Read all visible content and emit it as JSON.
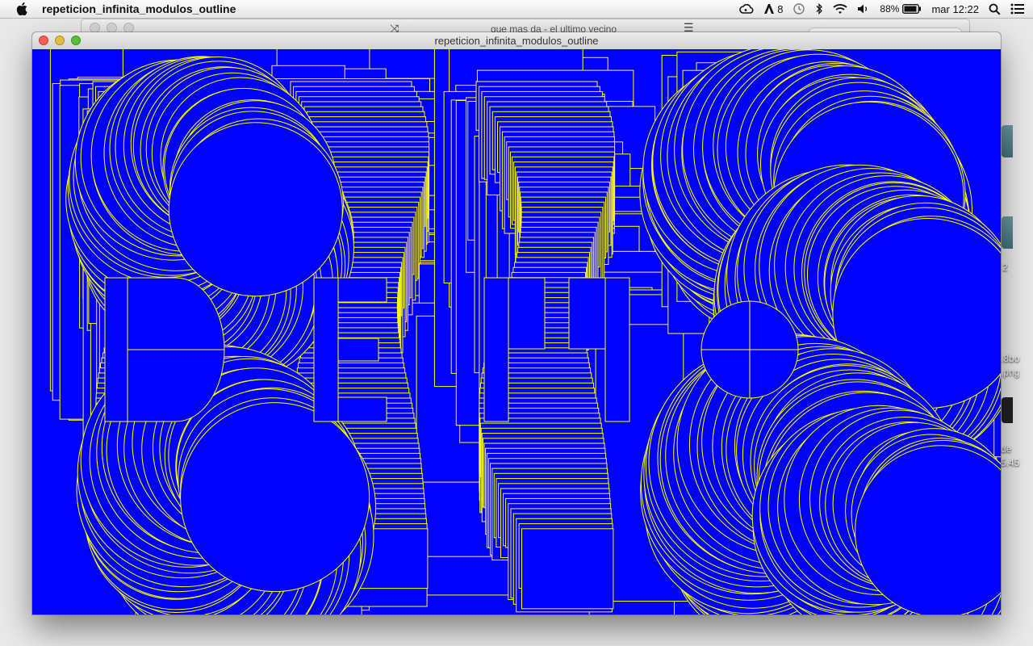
{
  "menubar": {
    "app_name": "repeticion_infinita_modulos_outline",
    "adobe_badge": "8",
    "battery": "88%",
    "clock": "mar 12:22"
  },
  "itunes": {
    "now_playing": "que mas da - el ultimo vecino"
  },
  "desktop": {
    "labels": [
      "2",
      ".8bo",
      ".png",
      "de",
      "5.45"
    ]
  },
  "window": {
    "title": "repeticion_infinita_modulos_outline"
  },
  "sketch": {
    "background": "#0000ff",
    "stroke": "#ffff00",
    "letters": [
      "D",
      "E",
      "M",
      "O"
    ]
  },
  "colors": {
    "close": "#fc5b57",
    "minimize": "#e5bf3c",
    "zoom": "#57c038"
  }
}
